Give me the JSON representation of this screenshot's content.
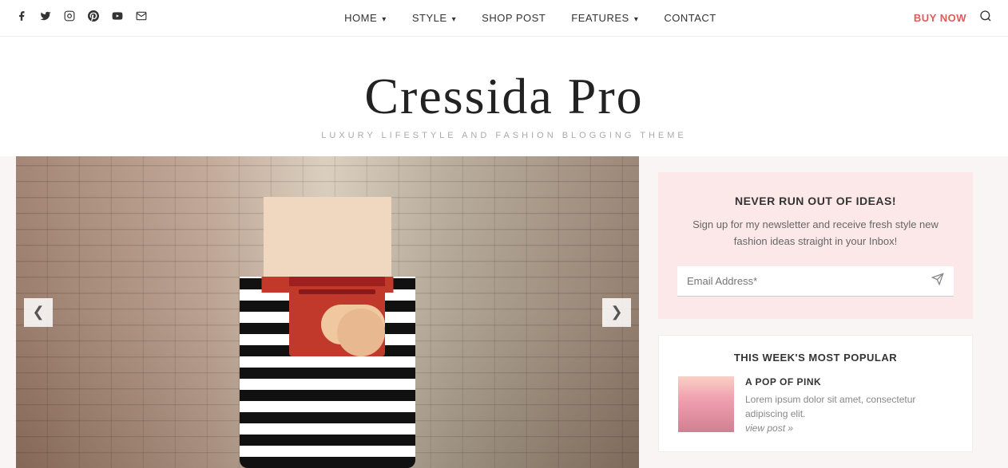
{
  "topNav": {
    "socialIcons": [
      {
        "name": "facebook-icon",
        "glyph": "f",
        "label": "Facebook"
      },
      {
        "name": "twitter-icon",
        "glyph": "t",
        "label": "Twitter"
      },
      {
        "name": "instagram-icon",
        "glyph": "◎",
        "label": "Instagram"
      },
      {
        "name": "pinterest-icon",
        "glyph": "p",
        "label": "Pinterest"
      },
      {
        "name": "youtube-icon",
        "glyph": "▶",
        "label": "YouTube"
      },
      {
        "name": "email-icon",
        "glyph": "✉",
        "label": "Email"
      }
    ],
    "menuItems": [
      {
        "label": "HOME",
        "hasDropdown": true
      },
      {
        "label": "STYLE",
        "hasDropdown": true
      },
      {
        "label": "SHOP POST",
        "hasDropdown": false
      },
      {
        "label": "FEATURES",
        "hasDropdown": true
      },
      {
        "label": "CONTACT",
        "hasDropdown": false
      }
    ],
    "buyNow": "BUY NOW",
    "searchLabel": "Search"
  },
  "brand": {
    "title": "Cressida Pro",
    "subtitle": "LUXURY LIFESTYLE AND FASHION BLOGGING THEME"
  },
  "slider": {
    "prevLabel": "❮",
    "nextLabel": "❯"
  },
  "newsletter": {
    "title": "NEVER RUN OUT OF IDEAS!",
    "description": "Sign up for my newsletter and receive fresh style new fashion ideas straight in your Inbox!",
    "emailPlaceholder": "Email Address*"
  },
  "popular": {
    "title": "THIS WEEK'S MOST POPULAR",
    "items": [
      {
        "title": "A POP OF PINK",
        "description": "Lorem ipsum dolor sit amet, consectetur adipiscing elit.",
        "linkText": "view post »"
      }
    ]
  }
}
